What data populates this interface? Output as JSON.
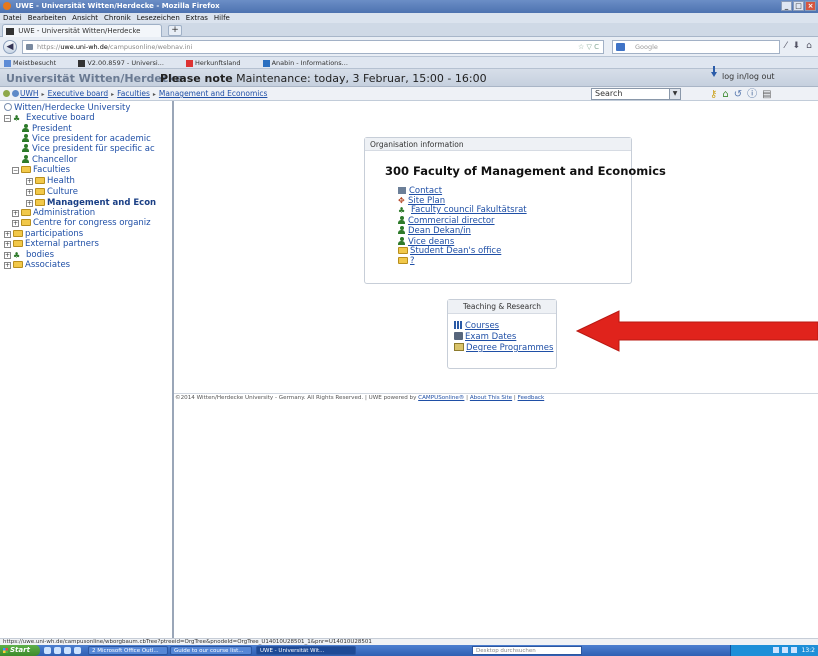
{
  "browser": {
    "window_title": "UWE - Universität Witten/Herdecke - Mozilla Firefox",
    "menu": [
      "Datei",
      "Bearbeiten",
      "Ansicht",
      "Chronik",
      "Lesezeichen",
      "Extras",
      "Hilfe"
    ],
    "tab_title": "UWE - Universität Witten/Herdecke",
    "new_tab": "+",
    "url_prefix": "https://",
    "url_host": "uwe.uni-wh.de",
    "url_path": "/campusonline/webnav.ini",
    "search_placeholder": "Google",
    "bookmarks": [
      "Meistbesucht",
      "V2.00.8597 - Universi...",
      "Herkunftsland",
      "Anabin - Informations..."
    ]
  },
  "app_header": {
    "title": "Universität Witten/Herdecke",
    "note_label": "Please note",
    "note_text": "Maintenance: today, 3 Februar, 15:00 - 16:00",
    "login_link": "log in/log out"
  },
  "crumbs": {
    "items": [
      "UWH",
      "Executive board",
      "Faculties",
      "Management and Economics"
    ],
    "search_select": "Search",
    "sep": "▸",
    "dd": "▼"
  },
  "icons": {
    "back": "back-arrow-icon",
    "key": "key-icon",
    "home": "home-icon",
    "refresh": "refresh-icon",
    "info": "info-icon",
    "print": "print-icon"
  },
  "tree": {
    "root": "Witten/Herdecke University",
    "executive_board": "Executive board",
    "president": "President",
    "vp_academic": "Vice president for academic",
    "vp_specific": "Vice president für specific ac",
    "chancellor": "Chancellor",
    "faculties": "Faculties",
    "health": "Health",
    "culture": "Culture",
    "management": "Management and Econ",
    "administration": "Administration",
    "congress": "Centre for congress organiz",
    "participations": "participations",
    "external_partners": "External partners",
    "bodies": "bodies",
    "associates": "Associates",
    "exp_minus": "−",
    "exp_plus": "+"
  },
  "org": {
    "header": "Organisation information",
    "heading": "300  Faculty of Management and Economics",
    "links": [
      "Contact",
      "Site Plan",
      "Faculty council Fakultätsrat",
      "Commercial director",
      "Dean Dekan/in",
      "Vice deans",
      "Student Dean's office",
      "?"
    ]
  },
  "teaching": {
    "header": "Teaching & Research",
    "links": [
      "Courses",
      "Exam Dates",
      "Degree Programmes"
    ]
  },
  "footer": {
    "copyright": "©2014 Witten/Herdecke University - Germany. All Rights Reserved. | UWE powered by ",
    "powered": "CAMPUSonline®",
    "sep": " | ",
    "about": "About This Site",
    "feedback": "Feedback"
  },
  "status_url": "https://uwe.uni-wh.de/campusonline/wborgbaum.cbTree?ptreeid=OrgTree&pnodeId=OrgTree_U14010U28501_1&pnr=U14010U28501",
  "taskbar": {
    "start": "Start",
    "tasks": [
      "2 Microsoft Office Outl...",
      "Guide to our course list...",
      "UWE - Universität Wit..."
    ],
    "desktop_search": "Desktop durchsuchen",
    "clock": "13:2"
  },
  "colors": {
    "accent_arrow": "#e0231c",
    "link": "#1f4fa6"
  }
}
